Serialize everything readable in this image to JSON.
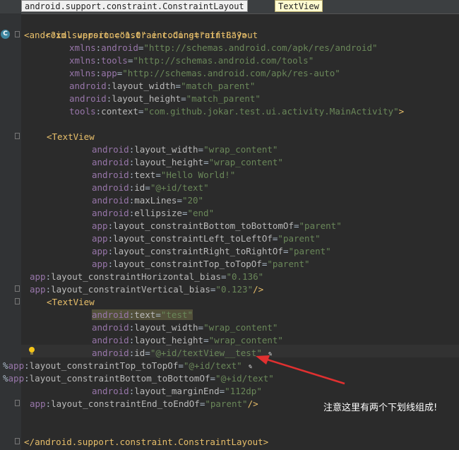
{
  "breadcrumb": {
    "items": [
      "android.support.constraint.ConstraintLayout",
      "TextView"
    ]
  },
  "gutter": {
    "class_icon_letter": "C"
  },
  "code": {
    "l1": {
      "text": "<?xml version=\"1.0\" encoding=\"utf-8\"?>"
    },
    "l2": {
      "open": "<",
      "tag": "android.support.constraint.ConstraintLayout"
    },
    "l3": {
      "ns": "xmlns",
      "sep": ":",
      "attr": "android",
      "eq": "=",
      "val": "\"http://schemas.android.com/apk/res/android\""
    },
    "l4": {
      "ns": "xmlns",
      "sep": ":",
      "attr": "tools",
      "eq": "=",
      "val": "\"http://schemas.android.com/tools\""
    },
    "l5": {
      "ns": "xmlns",
      "sep": ":",
      "attr": "app",
      "eq": "=",
      "val": "\"http://schemas.android.com/apk/res-auto\""
    },
    "l6": {
      "ns": "android",
      "sep": ":",
      "attr": "layout_width",
      "eq": "=",
      "val": "\"match_parent\""
    },
    "l7": {
      "ns": "android",
      "sep": ":",
      "attr": "layout_height",
      "eq": "=",
      "val": "\"match_parent\""
    },
    "l8": {
      "ns": "tools",
      "sep": ":",
      "attr": "context",
      "eq": "=",
      "val": "\"com.github.jokar.test.ui.activity.MainActivity\"",
      "close": ">"
    },
    "l10": {
      "open": "<",
      "tag": "TextView"
    },
    "l11": {
      "ns": "android",
      "sep": ":",
      "attr": "layout_width",
      "eq": "=",
      "val": "\"wrap_content\""
    },
    "l12": {
      "ns": "android",
      "sep": ":",
      "attr": "layout_height",
      "eq": "=",
      "val": "\"wrap_content\""
    },
    "l13": {
      "ns": "android",
      "sep": ":",
      "attr": "text",
      "eq": "=",
      "val": "\"Hello World!\""
    },
    "l14": {
      "ns": "android",
      "sep": ":",
      "attr": "id",
      "eq": "=",
      "val": "\"@+id/text\""
    },
    "l15": {
      "ns": "android",
      "sep": ":",
      "attr": "maxLines",
      "eq": "=",
      "val": "\"20\""
    },
    "l16": {
      "ns": "android",
      "sep": ":",
      "attr": "ellipsize",
      "eq": "=",
      "val": "\"end\""
    },
    "l17": {
      "ns": "app",
      "sep": ":",
      "attr": "layout_constraintBottom_toBottomOf",
      "eq": "=",
      "val": "\"parent\""
    },
    "l18": {
      "ns": "app",
      "sep": ":",
      "attr": "layout_constraintLeft_toLeftOf",
      "eq": "=",
      "val": "\"parent\""
    },
    "l19": {
      "ns": "app",
      "sep": ":",
      "attr": "layout_constraintRight_toRightOf",
      "eq": "=",
      "val": "\"parent\""
    },
    "l20": {
      "ns": "app",
      "sep": ":",
      "attr": "layout_constraintTop_toTopOf",
      "eq": "=",
      "val": "\"parent\""
    },
    "l21": {
      "ns": "app",
      "sep": ":",
      "attr": "layout_constraintHorizontal_bias",
      "eq": "=",
      "val": "\"0.136\""
    },
    "l22": {
      "ns": "app",
      "sep": ":",
      "attr": "layout_constraintVertical_bias",
      "eq": "=",
      "val": "\"0.123\"",
      "close": "/>"
    },
    "l23": {
      "open": "<",
      "tag": "TextView"
    },
    "l24": {
      "ns": "android",
      "sep": ":",
      "attr": "text",
      "eq": "=",
      "val": "\"test\""
    },
    "l25": {
      "ns": "android",
      "sep": ":",
      "attr": "layout_width",
      "eq": "=",
      "val": "\"wrap_content\""
    },
    "l26": {
      "ns": "android",
      "sep": ":",
      "attr": "layout_height",
      "eq": "=",
      "val": "\"wrap_content\""
    },
    "l27": {
      "ns": "android",
      "sep": ":",
      "attr": "id",
      "eq": "=",
      "val": "\"@+id/textView__test\"",
      "pencil": "✎"
    },
    "l28": {
      "prefix": "%",
      "ns": "app",
      "sep": ":",
      "attr": "layout_constraintTop_toTopOf",
      "eq": "=",
      "val": "\"@+id/text\"",
      "pencil": "✎"
    },
    "l29": {
      "prefix": "%",
      "ns": "app",
      "sep": ":",
      "attr": "layout_constraintBottom_toBottomOf",
      "eq": "=",
      "val": "\"@+id/text\""
    },
    "l30": {
      "ns": "android",
      "sep": ":",
      "attr": "layout_marginEnd",
      "eq": "=",
      "val": "\"112dp\""
    },
    "l31": {
      "ns": "app",
      "sep": ":",
      "attr": "layout_constraintEnd_toEndOf",
      "eq": "=",
      "val": "\"parent\"",
      "close": "/>"
    },
    "l34": {
      "open": "</",
      "tag": "android.support.constraint.ConstraintLayout",
      "close": ">"
    }
  },
  "annotation": {
    "text": "注意这里有两个下划线组成!",
    "color": "#ffffff",
    "arrow_color": "#e03030"
  },
  "colors": {
    "background": "#2b2b2b",
    "tag": "#e8bf6a",
    "namespace": "#9876aa",
    "value": "#6a8759",
    "highlight": "#52503a"
  }
}
